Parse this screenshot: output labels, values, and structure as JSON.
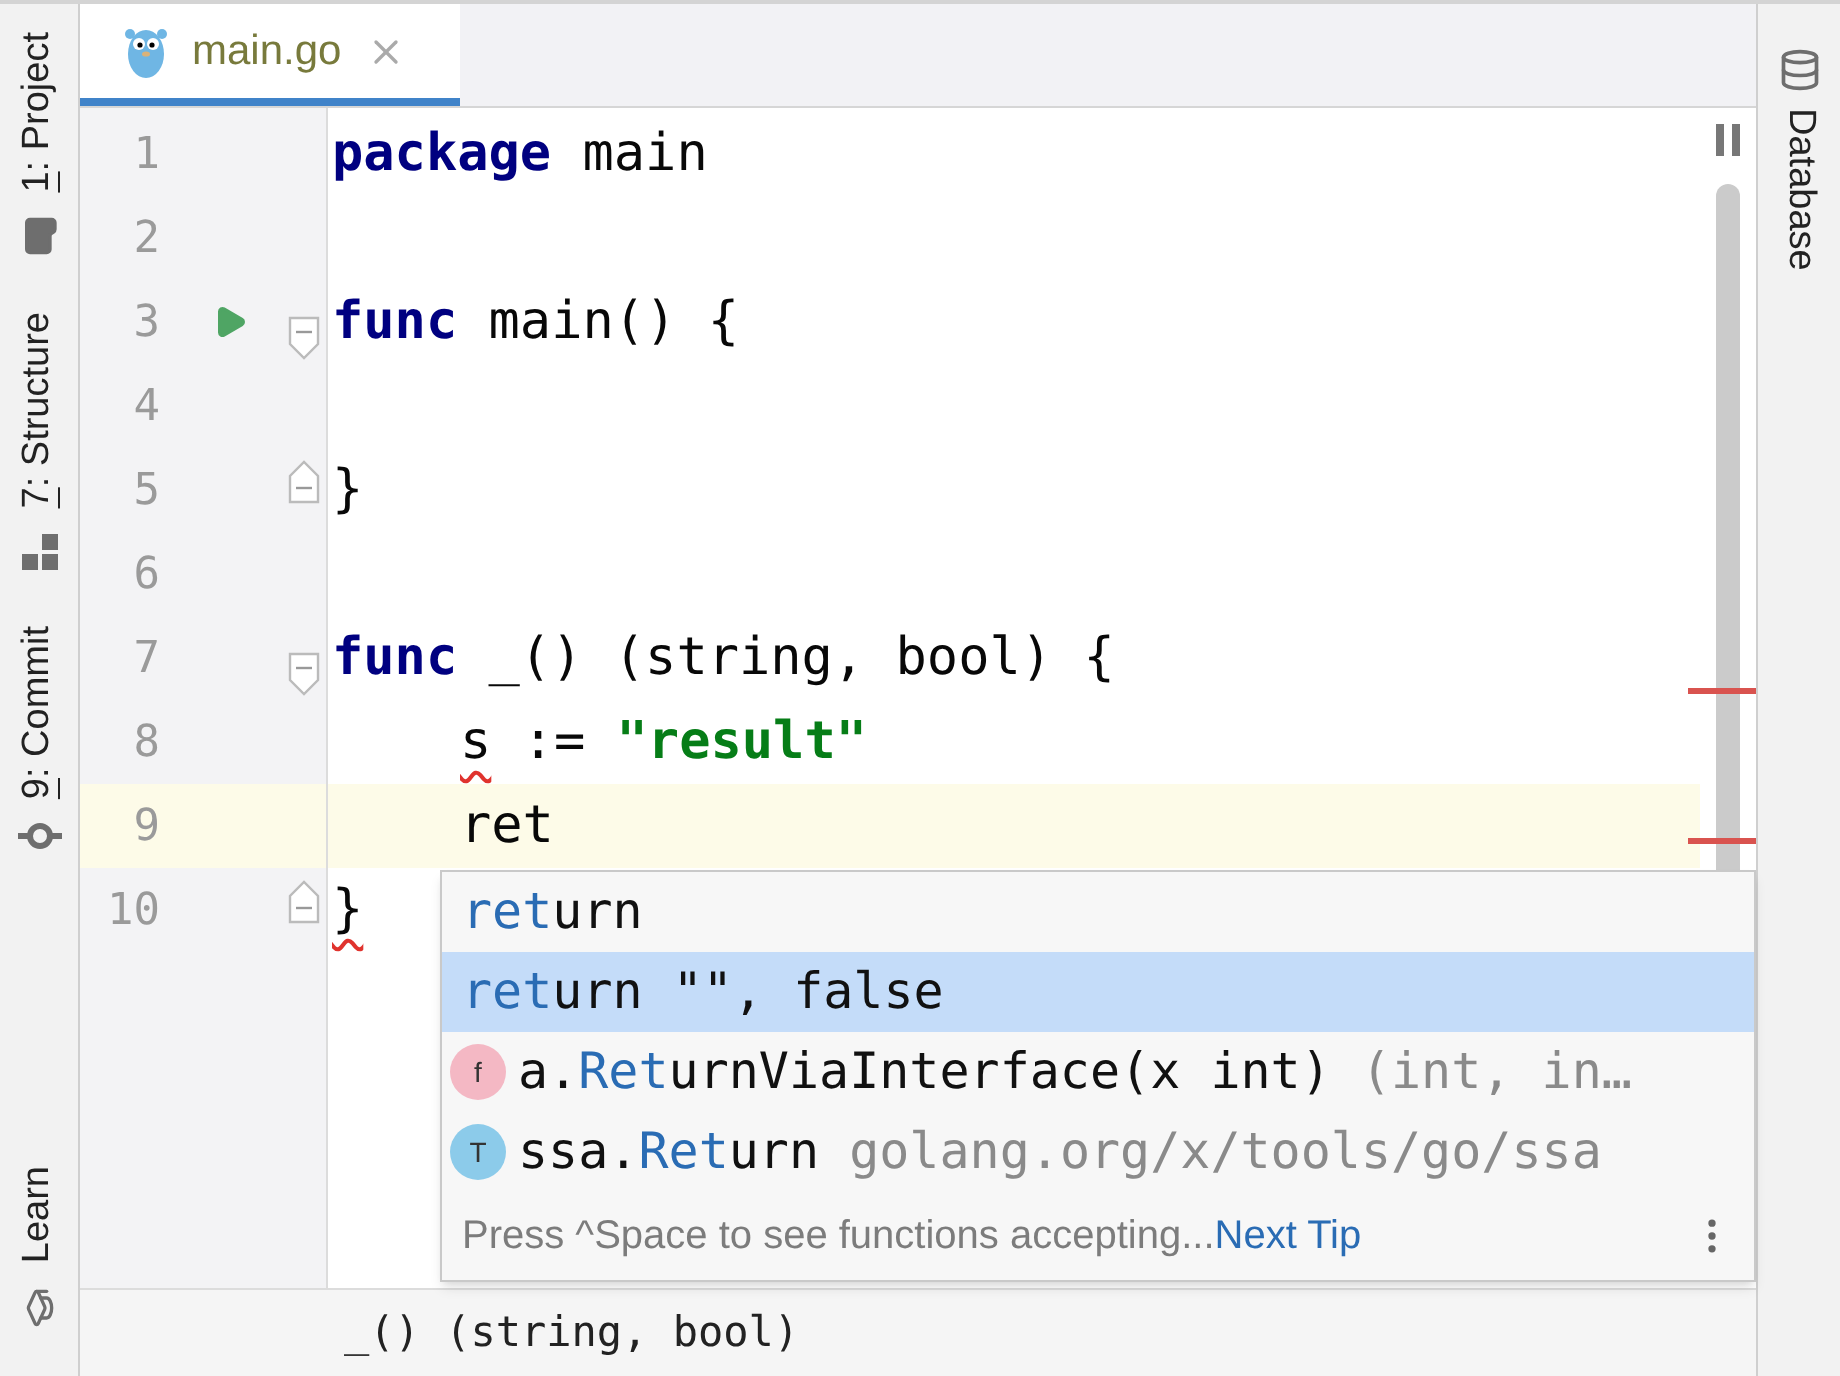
{
  "left_toolbar": [
    {
      "kind": "project",
      "mnemonic": "1",
      "label": ": Project"
    },
    {
      "kind": "structure",
      "mnemonic": "7",
      "label": ": Structure"
    },
    {
      "kind": "commit",
      "mnemonic": "9",
      "label": ": Commit"
    },
    {
      "kind": "learn",
      "label": "Learn"
    }
  ],
  "right_toolbar": [
    {
      "kind": "database",
      "label": "Database"
    }
  ],
  "tabs": [
    {
      "label": "main.go",
      "selected": true
    }
  ],
  "editor": {
    "lines": [
      {
        "number": "1",
        "current": false,
        "run": false,
        "fold_start": false,
        "fold_end": false,
        "indented": false,
        "tokens": [
          {
            "kind": "keyword",
            "text": "package",
            "error": false
          },
          {
            "kind": "plain",
            "text": " main",
            "error": false
          }
        ]
      },
      {
        "number": "2",
        "current": false,
        "run": false,
        "fold_start": false,
        "fold_end": false
      },
      {
        "number": "3",
        "current": false,
        "run": true,
        "fold_start": true,
        "fold_end": false,
        "indented": false,
        "tokens": [
          {
            "kind": "keyword",
            "text": "func",
            "error": false
          },
          {
            "kind": "plain",
            "text": " main() {",
            "error": false
          }
        ]
      },
      {
        "number": "4",
        "current": false,
        "run": false,
        "fold_start": false,
        "fold_end": false
      },
      {
        "number": "5",
        "current": false,
        "run": false,
        "fold_start": false,
        "fold_end": true,
        "indented": false,
        "tokens": [
          {
            "kind": "plain",
            "text": "}",
            "error": false
          }
        ]
      },
      {
        "number": "6",
        "current": false,
        "run": false,
        "fold_start": false,
        "fold_end": false
      },
      {
        "number": "7",
        "current": false,
        "run": false,
        "fold_start": true,
        "fold_end": false,
        "indented": false,
        "tokens": [
          {
            "kind": "keyword",
            "text": "func",
            "error": false
          },
          {
            "kind": "plain",
            "text": " _() (string, bool) {",
            "error": false
          }
        ]
      },
      {
        "number": "8",
        "current": false,
        "run": false,
        "fold_start": false,
        "fold_end": false,
        "indented": true,
        "tokens": [
          {
            "kind": "plain",
            "text": "s",
            "error": true
          },
          {
            "kind": "plain",
            "text": " := ",
            "error": false
          },
          {
            "kind": "string",
            "text": "\"result\"",
            "error": false
          }
        ]
      },
      {
        "number": "9",
        "current": true,
        "run": false,
        "fold_start": false,
        "fold_end": false,
        "indented": true,
        "tokens": [
          {
            "kind": "plain",
            "text": "ret",
            "error": false
          }
        ]
      },
      {
        "number": "10",
        "current": false,
        "run": false,
        "fold_start": false,
        "fold_end": true,
        "indented": false,
        "tokens": [
          {
            "kind": "plain",
            "text": "}",
            "error": true
          }
        ]
      }
    ]
  },
  "completion": {
    "items": [
      {
        "kind": "keyword",
        "selected": false,
        "match": "ret",
        "rest": "urn"
      },
      {
        "kind": "keyword",
        "selected": true,
        "match": "ret",
        "rest": "urn \"\", false"
      },
      {
        "kind": "function",
        "badge": "f",
        "color": "#f4b8c4",
        "selected": false,
        "prefix": "a.",
        "match": "Ret",
        "rest": "urnViaInterface(x int)",
        "tail": "(int, in…"
      },
      {
        "kind": "type",
        "badge": "T",
        "color": "#8ccbea",
        "selected": false,
        "prefix": "ssa.",
        "match": "Ret",
        "rest": "urn",
        "tail": "golang.org/x/tools/go/ssa"
      }
    ],
    "hint": "Press ^Space to see functions accepting...",
    "link": "Next Tip"
  },
  "status_bar": {
    "breadcrumb": "_() (string, bool)"
  }
}
